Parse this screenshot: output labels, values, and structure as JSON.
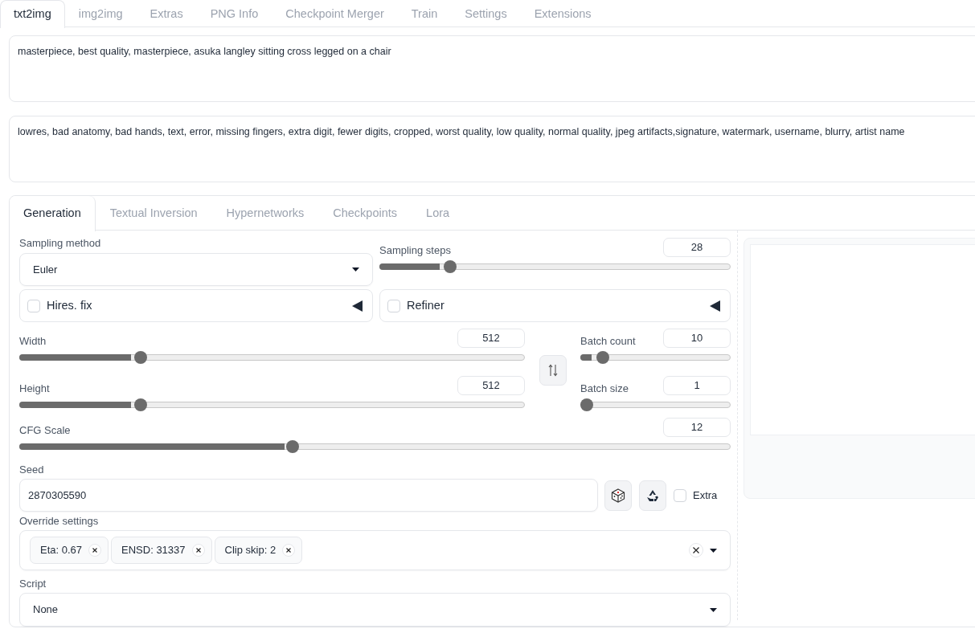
{
  "top_tabs": [
    {
      "label": "txt2img",
      "selected": true
    },
    {
      "label": "img2img",
      "selected": false
    },
    {
      "label": "Extras",
      "selected": false
    },
    {
      "label": "PNG Info",
      "selected": false
    },
    {
      "label": "Checkpoint Merger",
      "selected": false
    },
    {
      "label": "Train",
      "selected": false
    },
    {
      "label": "Settings",
      "selected": false
    },
    {
      "label": "Extensions",
      "selected": false
    }
  ],
  "prompt": {
    "value": "masterpiece, best quality, masterpiece, asuka langley sitting cross legged on a chair"
  },
  "negative_prompt": {
    "value": "lowres, bad anatomy, bad hands, text, error, missing fingers, extra digit, fewer digits, cropped, worst quality, low quality, normal quality, jpeg artifacts,signature, watermark, username, blurry, artist name"
  },
  "generation_tabs": [
    {
      "label": "Generation",
      "selected": true
    },
    {
      "label": "Textual Inversion",
      "selected": false
    },
    {
      "label": "Hypernetworks",
      "selected": false
    },
    {
      "label": "Checkpoints",
      "selected": false
    },
    {
      "label": "Lora",
      "selected": false
    }
  ],
  "sampling_method": {
    "label": "Sampling method",
    "value": "Euler"
  },
  "sampling_steps": {
    "label": "Sampling steps",
    "value": "28",
    "level": 0.19
  },
  "accordions": [
    {
      "label": "Hires. fix",
      "checked": false
    },
    {
      "label": "Refiner",
      "checked": false
    }
  ],
  "width": {
    "label": "Width",
    "value": "512",
    "level": 0.234
  },
  "height": {
    "label": "Height",
    "value": "512",
    "level": 0.234
  },
  "batch_count": {
    "label": "Batch count",
    "value": "10",
    "level": 0.118
  },
  "batch_size": {
    "label": "Batch size",
    "value": "1",
    "level": 0
  },
  "cfg_scale": {
    "label": "CFG Scale",
    "value": "12",
    "level": 0.382
  },
  "seed": {
    "label": "Seed",
    "value": "2870305590",
    "extra": {
      "label": "Extra",
      "checked": false
    }
  },
  "override_settings": {
    "label": "Override settings",
    "chips": [
      "Eta: 0.67",
      "ENSD: 31337",
      "Clip skip: 2"
    ]
  },
  "script": {
    "label": "Script",
    "value": "None"
  }
}
